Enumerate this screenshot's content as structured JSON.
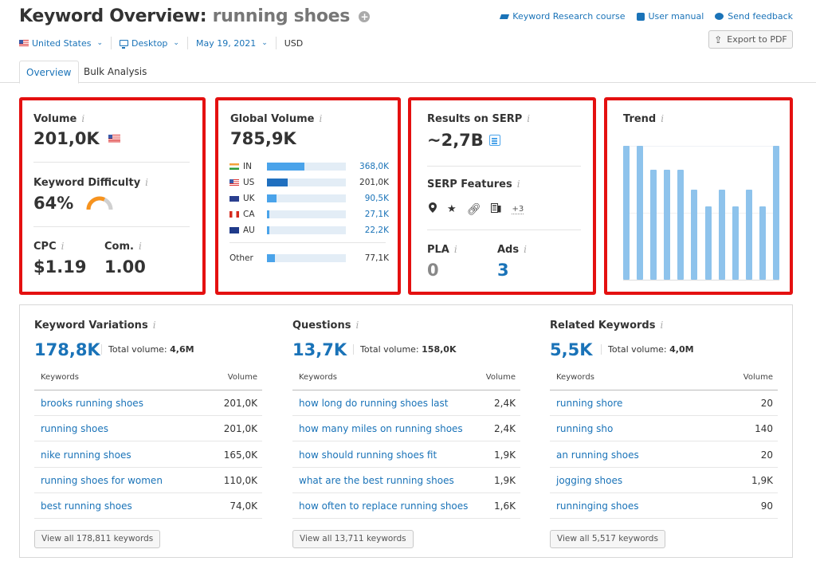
{
  "header": {
    "title_prefix": "Keyword Overview:",
    "keyword": "running shoes",
    "add_icon": "plus-circle-icon",
    "filters": {
      "country": "United States",
      "device": "Desktop",
      "date": "May 19, 2021",
      "currency": "USD"
    },
    "links": [
      {
        "label": "Keyword Research course",
        "icon": "graduation-cap-icon"
      },
      {
        "label": "User manual",
        "icon": "book-icon"
      },
      {
        "label": "Send feedback",
        "icon": "speech-bubble-icon"
      }
    ],
    "export_label": "Export to PDF"
  },
  "tabs": [
    {
      "label": "Overview",
      "active": true
    },
    {
      "label": "Bulk Analysis",
      "active": false
    }
  ],
  "cards": {
    "volume": {
      "label": "Volume",
      "value": "201,0K",
      "flag": "us-flag-icon"
    },
    "kd": {
      "label": "Keyword Difficulty",
      "value": "64%",
      "percent": 64,
      "gauge_color": "#f7931e"
    },
    "cpc": {
      "label": "CPC",
      "value": "$1.19"
    },
    "com": {
      "label": "Com.",
      "value": "1.00"
    },
    "global": {
      "label": "Global Volume",
      "value": "785,9K",
      "countries": [
        {
          "code": "IN",
          "value": "368,0K",
          "share": 0.47,
          "highlight": false
        },
        {
          "code": "US",
          "value": "201,0K",
          "share": 0.26,
          "highlight": true
        },
        {
          "code": "UK",
          "value": "90,5K",
          "share": 0.12,
          "highlight": false
        },
        {
          "code": "CA",
          "value": "27,1K",
          "share": 0.035,
          "highlight": false
        },
        {
          "code": "AU",
          "value": "22,2K",
          "share": 0.028,
          "highlight": false
        }
      ],
      "other": {
        "label": "Other",
        "value": "77,1K",
        "share": 0.1
      }
    },
    "serp": {
      "label": "Results on SERP",
      "value": "~2,7B",
      "features_label": "SERP Features",
      "features": [
        "location-pin-icon",
        "star-icon",
        "link-icon",
        "news-icon"
      ],
      "more": "+3",
      "pla_label": "PLA",
      "pla_value": "0",
      "ads_label": "Ads",
      "ads_value": "3"
    },
    "trend": {
      "label": "Trend"
    }
  },
  "chart_data": {
    "type": "bar",
    "title": "Trend",
    "categories": [
      "1",
      "2",
      "3",
      "4",
      "5",
      "6",
      "7",
      "8",
      "9",
      "10",
      "11",
      "12"
    ],
    "values": [
      1.0,
      1.0,
      0.82,
      0.82,
      0.82,
      0.67,
      0.55,
      0.67,
      0.55,
      0.67,
      0.55,
      1.0
    ],
    "ylim": [
      0,
      1
    ],
    "xlabel": "",
    "ylabel": ""
  },
  "sections": [
    {
      "title": "Keyword Variations",
      "count": "178,8K",
      "total_label": "Total volume:",
      "total_value": "4,6M",
      "col_keywords": "Keywords",
      "col_volume": "Volume",
      "rows": [
        {
          "keyword": "brooks running shoes",
          "volume": "201,0K"
        },
        {
          "keyword": "running shoes",
          "volume": "201,0K"
        },
        {
          "keyword": "nike running shoes",
          "volume": "165,0K"
        },
        {
          "keyword": "running shoes for women",
          "volume": "110,0K"
        },
        {
          "keyword": "best running shoes",
          "volume": "74,0K"
        }
      ],
      "view_all": "View all 178,811 keywords"
    },
    {
      "title": "Questions",
      "count": "13,7K",
      "total_label": "Total volume:",
      "total_value": "158,0K",
      "col_keywords": "Keywords",
      "col_volume": "Volume",
      "rows": [
        {
          "keyword": "how long do running shoes last",
          "volume": "2,4K"
        },
        {
          "keyword": "how many miles on running shoes",
          "volume": "2,4K"
        },
        {
          "keyword": "how should running shoes fit",
          "volume": "1,9K"
        },
        {
          "keyword": "what are the best running shoes",
          "volume": "1,9K"
        },
        {
          "keyword": "how often to replace running shoes",
          "volume": "1,6K"
        }
      ],
      "view_all": "View all 13,711 keywords"
    },
    {
      "title": "Related Keywords",
      "count": "5,5K",
      "total_label": "Total volume:",
      "total_value": "4,0M",
      "col_keywords": "Keywords",
      "col_volume": "Volume",
      "rows": [
        {
          "keyword": "running shore",
          "volume": "20"
        },
        {
          "keyword": "running sho",
          "volume": "140"
        },
        {
          "keyword": "an running shoes",
          "volume": "20"
        },
        {
          "keyword": "jogging shoes",
          "volume": "1,9K"
        },
        {
          "keyword": "runninging shoes",
          "volume": "90"
        }
      ],
      "view_all": "View all 5,517 keywords"
    }
  ],
  "colors": {
    "accent": "#1a73b8",
    "highlight_border": "#e41010",
    "trend_bar": "#8ec3ec",
    "kd_gauge": "#f7931e"
  }
}
